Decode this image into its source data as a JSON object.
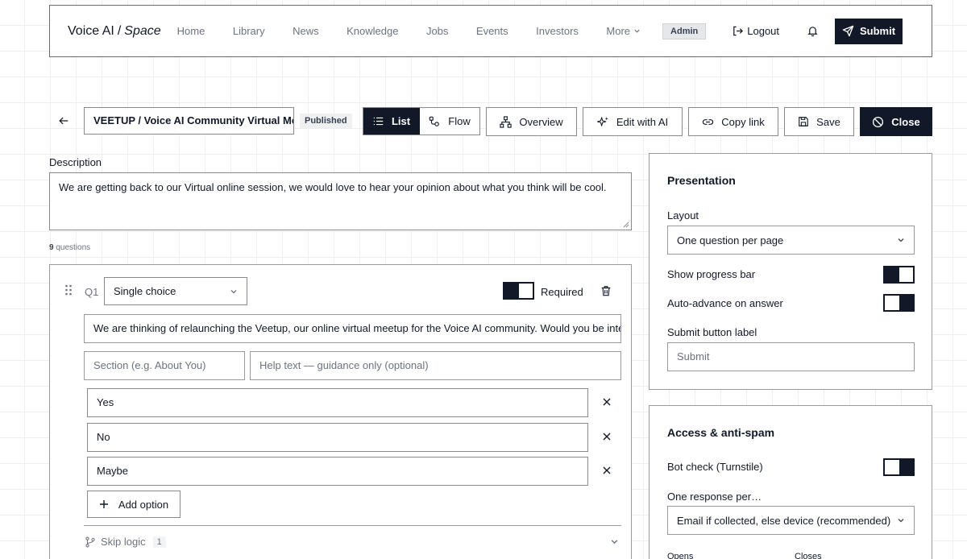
{
  "nav": {
    "brand_main": "Voice AI",
    "brand_slash": "/",
    "brand_sub": "Space",
    "links": [
      "Home",
      "Library",
      "News",
      "Knowledge",
      "Jobs",
      "Events",
      "Investors",
      "More"
    ],
    "admin_badge": "Admin",
    "logout_label": "Logout",
    "submit_label": "Submit"
  },
  "toolbar": {
    "title_value": "VEETUP / Voice AI Community Virtual Meetup",
    "status_badge": "Published",
    "view_list": "List",
    "view_flow": "Flow",
    "active_view": "List",
    "overview": "Overview",
    "edit_ai": "Edit with AI",
    "copy_link": "Copy link",
    "save": "Save",
    "close": "Close"
  },
  "form": {
    "description_label": "Description",
    "description_value": "We are getting back to our Virtual online session, we would love to hear your opinion about what you think will be cool.",
    "question_count": "9",
    "question_count_suffix": "questions"
  },
  "question": {
    "number": "Q1",
    "type": "Single choice",
    "required_label": "Required",
    "required": true,
    "text": "We are thinking of relaunching the Veetup, our online virtual meetup for the Voice AI community. Would you be interested in joining?",
    "section_placeholder": "Section (e.g. About You)",
    "help_placeholder": "Help text — guidance only (optional)",
    "options": [
      "Yes",
      "No",
      "Maybe"
    ],
    "add_option": "Add option",
    "skip_logic_label": "Skip logic",
    "skip_logic_count": "1"
  },
  "presentation": {
    "title": "Presentation",
    "layout_label": "Layout",
    "layout_value": "One question per page",
    "progress_label": "Show progress bar",
    "progress_on": true,
    "auto_advance_label": "Auto-advance on answer",
    "auto_advance_on": false,
    "submit_label_label": "Submit button label",
    "submit_label_placeholder": "Submit"
  },
  "access": {
    "title": "Access & anti-spam",
    "bot_check_label": "Bot check (Turnstile)",
    "bot_check_on": false,
    "one_response_label": "One response per…",
    "one_response_value": "Email if collected, else device (recommended)",
    "opens_label": "Opens",
    "closes_label": "Closes"
  },
  "colors": {
    "primary": "#111827",
    "muted_text": "#6b7280",
    "border": "#8a8a8a",
    "badge_bg": "#e5e7eb"
  }
}
